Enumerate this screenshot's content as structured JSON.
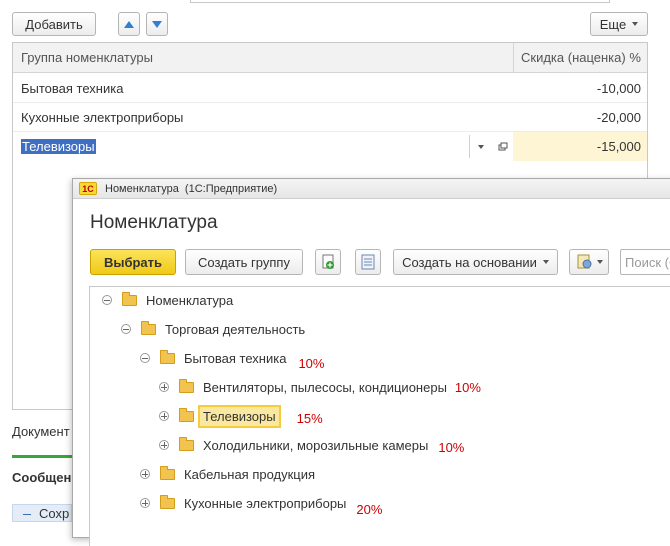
{
  "toolbar": {
    "add_label": "Добавить",
    "more_label": "Еще"
  },
  "grid": {
    "columns": [
      "Группа номенклатуры",
      "Скидка (наценка) %"
    ],
    "rows": [
      {
        "name": "Бытовая техника",
        "value": "-10,000"
      },
      {
        "name": "Кухонные электроприборы",
        "value": "-20,000"
      },
      {
        "name": "Телевизоры",
        "value": "-15,000"
      }
    ]
  },
  "background_labels": {
    "document": "Документ",
    "messages": "Сообщен",
    "message_item": "Сохр"
  },
  "dialog": {
    "app_badge": "1С",
    "window_title": "Номенклатура  (1С:Предприятие)",
    "heading": "Номенклатура",
    "buttons": {
      "select": "Выбрать",
      "create_group": "Создать группу",
      "create_based_on": "Создать на основании"
    },
    "search_placeholder": "Поиск (Ctrl+F)",
    "tree": [
      {
        "label": "Номенклатура",
        "pct": ""
      },
      {
        "label": "Торговая деятельность",
        "pct": ""
      },
      {
        "label": "Бытовая техника",
        "pct": "10%"
      },
      {
        "label": "Вентиляторы, пылесосы, кондиционеры",
        "pct": "10%"
      },
      {
        "label": "Телевизоры",
        "pct": "15%"
      },
      {
        "label": "Холодильники, морозильные камеры",
        "pct": "10%"
      },
      {
        "label": "Кабельная продукция",
        "pct": ""
      },
      {
        "label": "Кухонные электроприборы",
        "pct": "20%"
      }
    ]
  },
  "colors": {
    "accent_yellow": "#f7d83a",
    "selected_row": "#fdf5d3",
    "text_selection": "#3f6fc0",
    "annotation_red": "#d00000",
    "arrow_blue": "#2f7fd3",
    "messages_green": "#3aa63a"
  }
}
